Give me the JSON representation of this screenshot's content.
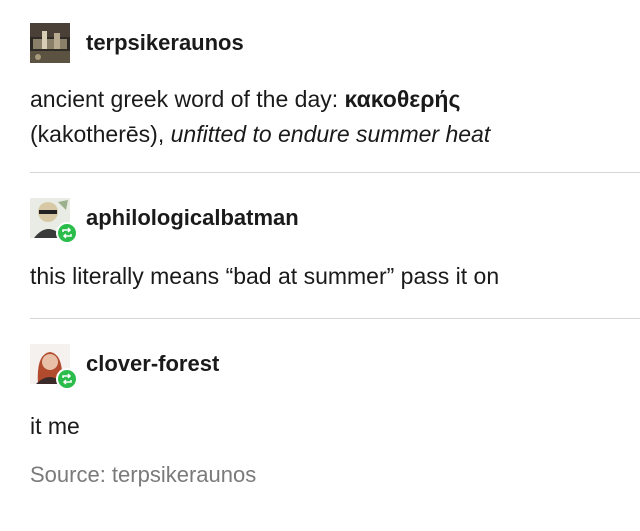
{
  "posts": [
    {
      "username": "terpsikeraunos",
      "body_plain": "ancient greek word of the day: ",
      "body_bold": "κακοθερής",
      "body_line2_plain": "(kakotherēs), ",
      "body_line2_italic": "unfitted to endure summer heat"
    },
    {
      "username": "aphilologicalbatman",
      "body": "this literally means “bad at summer” pass it on"
    },
    {
      "username": "clover-forest",
      "body": "it me"
    }
  ],
  "source": "Source: terpsikeraunos",
  "colors": {
    "reblog_badge": "#2bbd4b",
    "divider": "#d6d6d6",
    "source_text": "#7a7a7a"
  },
  "icons": {
    "reblog": "reblog-icon"
  }
}
